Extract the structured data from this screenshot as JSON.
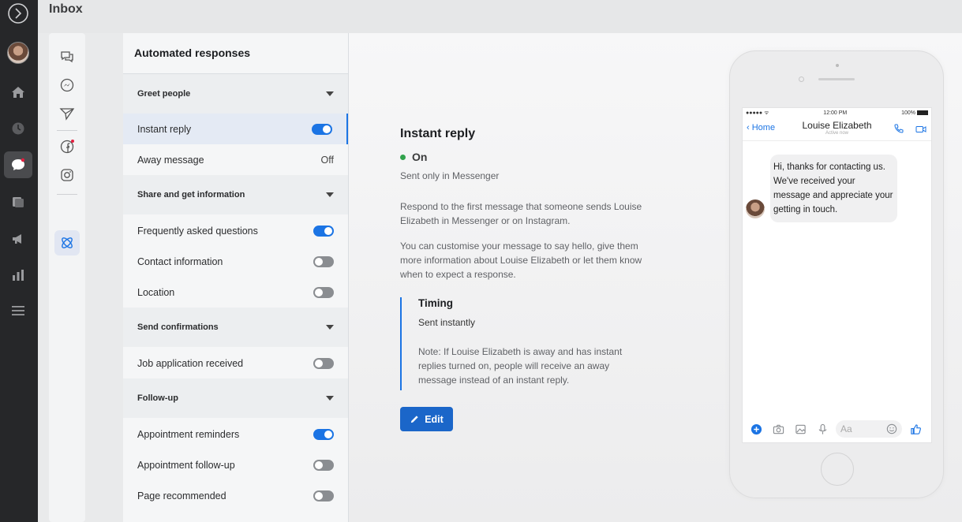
{
  "app": {
    "title": "Inbox"
  },
  "rail": {
    "icons": [
      "logo-icon",
      "avatar",
      "home-icon",
      "clock-icon",
      "chat-icon",
      "pages-icon",
      "megaphone-icon",
      "chart-icon",
      "menu-icon"
    ]
  },
  "iconcol": {
    "icons": [
      "comments-icon",
      "messenger-icon",
      "send-icon",
      "facebook-icon",
      "instagram-icon",
      "automation-icon"
    ]
  },
  "panel": {
    "title": "Automated responses",
    "sections": [
      {
        "label": "Greet people",
        "items": [
          {
            "label": "Instant reply",
            "state": "on"
          },
          {
            "label": "Away message",
            "state": "Off"
          }
        ]
      },
      {
        "label": "Share and get information",
        "items": [
          {
            "label": "Frequently asked questions",
            "state": "on"
          },
          {
            "label": "Contact information",
            "state": "off"
          },
          {
            "label": "Location",
            "state": "off"
          }
        ]
      },
      {
        "label": "Send confirmations",
        "items": [
          {
            "label": "Job application received",
            "state": "off"
          }
        ]
      },
      {
        "label": "Follow-up",
        "items": [
          {
            "label": "Appointment reminders",
            "state": "on"
          },
          {
            "label": "Appointment follow-up",
            "state": "off"
          },
          {
            "label": "Page recommended",
            "state": "off"
          }
        ]
      }
    ]
  },
  "detail": {
    "title": "Instant reply",
    "status": "On",
    "scope": "Sent only in Messenger",
    "para1": "Respond to the first message that someone sends Louise Elizabeth in Messenger or on Instagram.",
    "para2": "You can customise your message to say hello, give them more information about Louise Elizabeth or let them know when to expect a response.",
    "timing_title": "Timing",
    "timing_value": "Sent instantly",
    "note": "Note: If Louise Elizabeth is away and has instant replies turned on, people will receive an away message instead of an instant reply.",
    "edit_label": "Edit"
  },
  "preview": {
    "status_left": "●●●●● ᯤ",
    "time": "12:00 PM",
    "battery": "100%",
    "back_label": "Home",
    "contact_name": "Louise Elizabeth",
    "contact_sub": "Active now",
    "message": "Hi, thanks for contacting us. We've received your message and appreciate your getting in touch.",
    "composer_placeholder": "Aa"
  },
  "colors": {
    "accent": "#1b74e4",
    "status_on": "#31a24c",
    "rail": "#262729"
  }
}
